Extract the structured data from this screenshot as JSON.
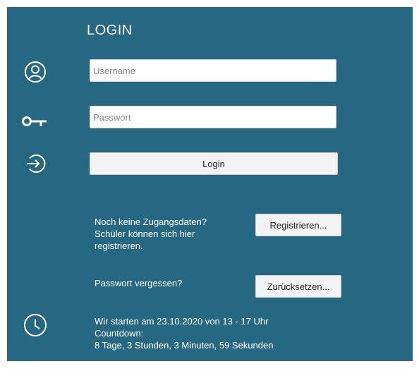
{
  "login": {
    "title": "LOGIN",
    "username_placeholder": "Username",
    "password_placeholder": "Passwort",
    "login_button": "Login"
  },
  "register": {
    "line1": "Noch keine Zugangsdaten?",
    "line2": "Schüler können sich hier",
    "line3": "registrieren.",
    "button": "Registrieren..."
  },
  "reset": {
    "text": "Passwort vergessen?",
    "button": "Zurücksetzen..."
  },
  "countdown": {
    "line1": "Wir starten am 23.10.2020 von 13 - 17 Uhr",
    "line2": "Countdown:",
    "line3": "8 Tage, 3 Stunden, 3 Minuten, 59 Sekunden"
  },
  "icons": {
    "user": "user-icon",
    "key": "key-icon",
    "login": "login-icon",
    "clock": "clock-icon"
  },
  "colors": {
    "panel_background": "#266882",
    "button_background": "#f3f3f3"
  }
}
